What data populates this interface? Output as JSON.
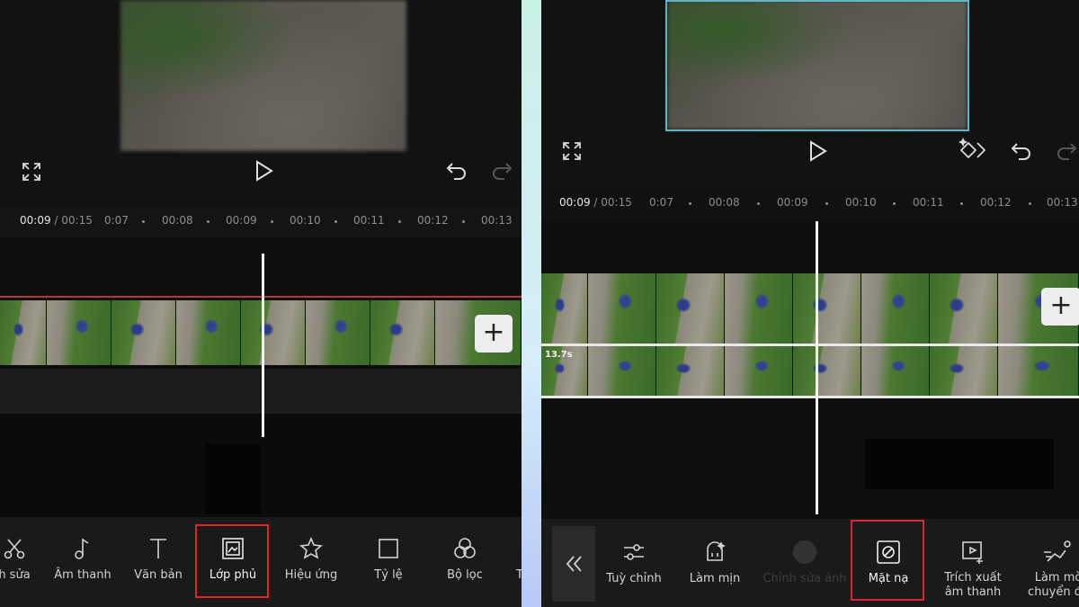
{
  "left_panel": {
    "timeline": {
      "current_time": "00:09",
      "total_time": " / 00:15",
      "ticks": [
        "0:07",
        "00:08",
        "00:09",
        "00:10",
        "00:11",
        "00:12",
        "00:13"
      ]
    },
    "add_button": "+",
    "toolbar": {
      "items": [
        {
          "label": "h sửa",
          "icon": "scissors-icon"
        },
        {
          "label": "Âm thanh",
          "icon": "music-note-icon"
        },
        {
          "label": "Văn bản",
          "icon": "text-icon"
        },
        {
          "label": "Lớp phủ",
          "icon": "overlay-icon",
          "highlighted": true
        },
        {
          "label": "Hiệu ứng",
          "icon": "star-effect-icon"
        },
        {
          "label": "Tỷ lệ",
          "icon": "ratio-square-icon"
        },
        {
          "label": "Bộ lọc",
          "icon": "filter-circles-icon"
        },
        {
          "label": "T",
          "icon": ""
        }
      ]
    }
  },
  "right_panel": {
    "timeline": {
      "current_time": "00:09",
      "total_time": " / 00:15",
      "ticks": [
        "0:07",
        "00:08",
        "00:09",
        "00:10",
        "00:11",
        "00:12",
        "00:13"
      ]
    },
    "overlay_duration": "13.7s",
    "add_button": "+",
    "toolbar": {
      "items": [
        {
          "label": "Tuỳ chỉnh",
          "icon": "sliders-icon"
        },
        {
          "label": "Làm mịn",
          "icon": "smooth-face-icon"
        },
        {
          "label": "Chỉnh sửa ảnh",
          "icon": "photo-edit-icon",
          "disabled": true
        },
        {
          "label": "Mặt nạ",
          "icon": "mask-icon",
          "highlighted": true
        },
        {
          "label": "Trích xuất âm thanh",
          "icon": "extract-audio-icon"
        },
        {
          "label": "Làm mờ chuyển độ",
          "icon": "motion-blur-icon"
        }
      ]
    }
  },
  "colors": {
    "highlight": "#e0252a",
    "playhead": "#f2f2f2",
    "selection_frame": "#5fb6c4"
  }
}
